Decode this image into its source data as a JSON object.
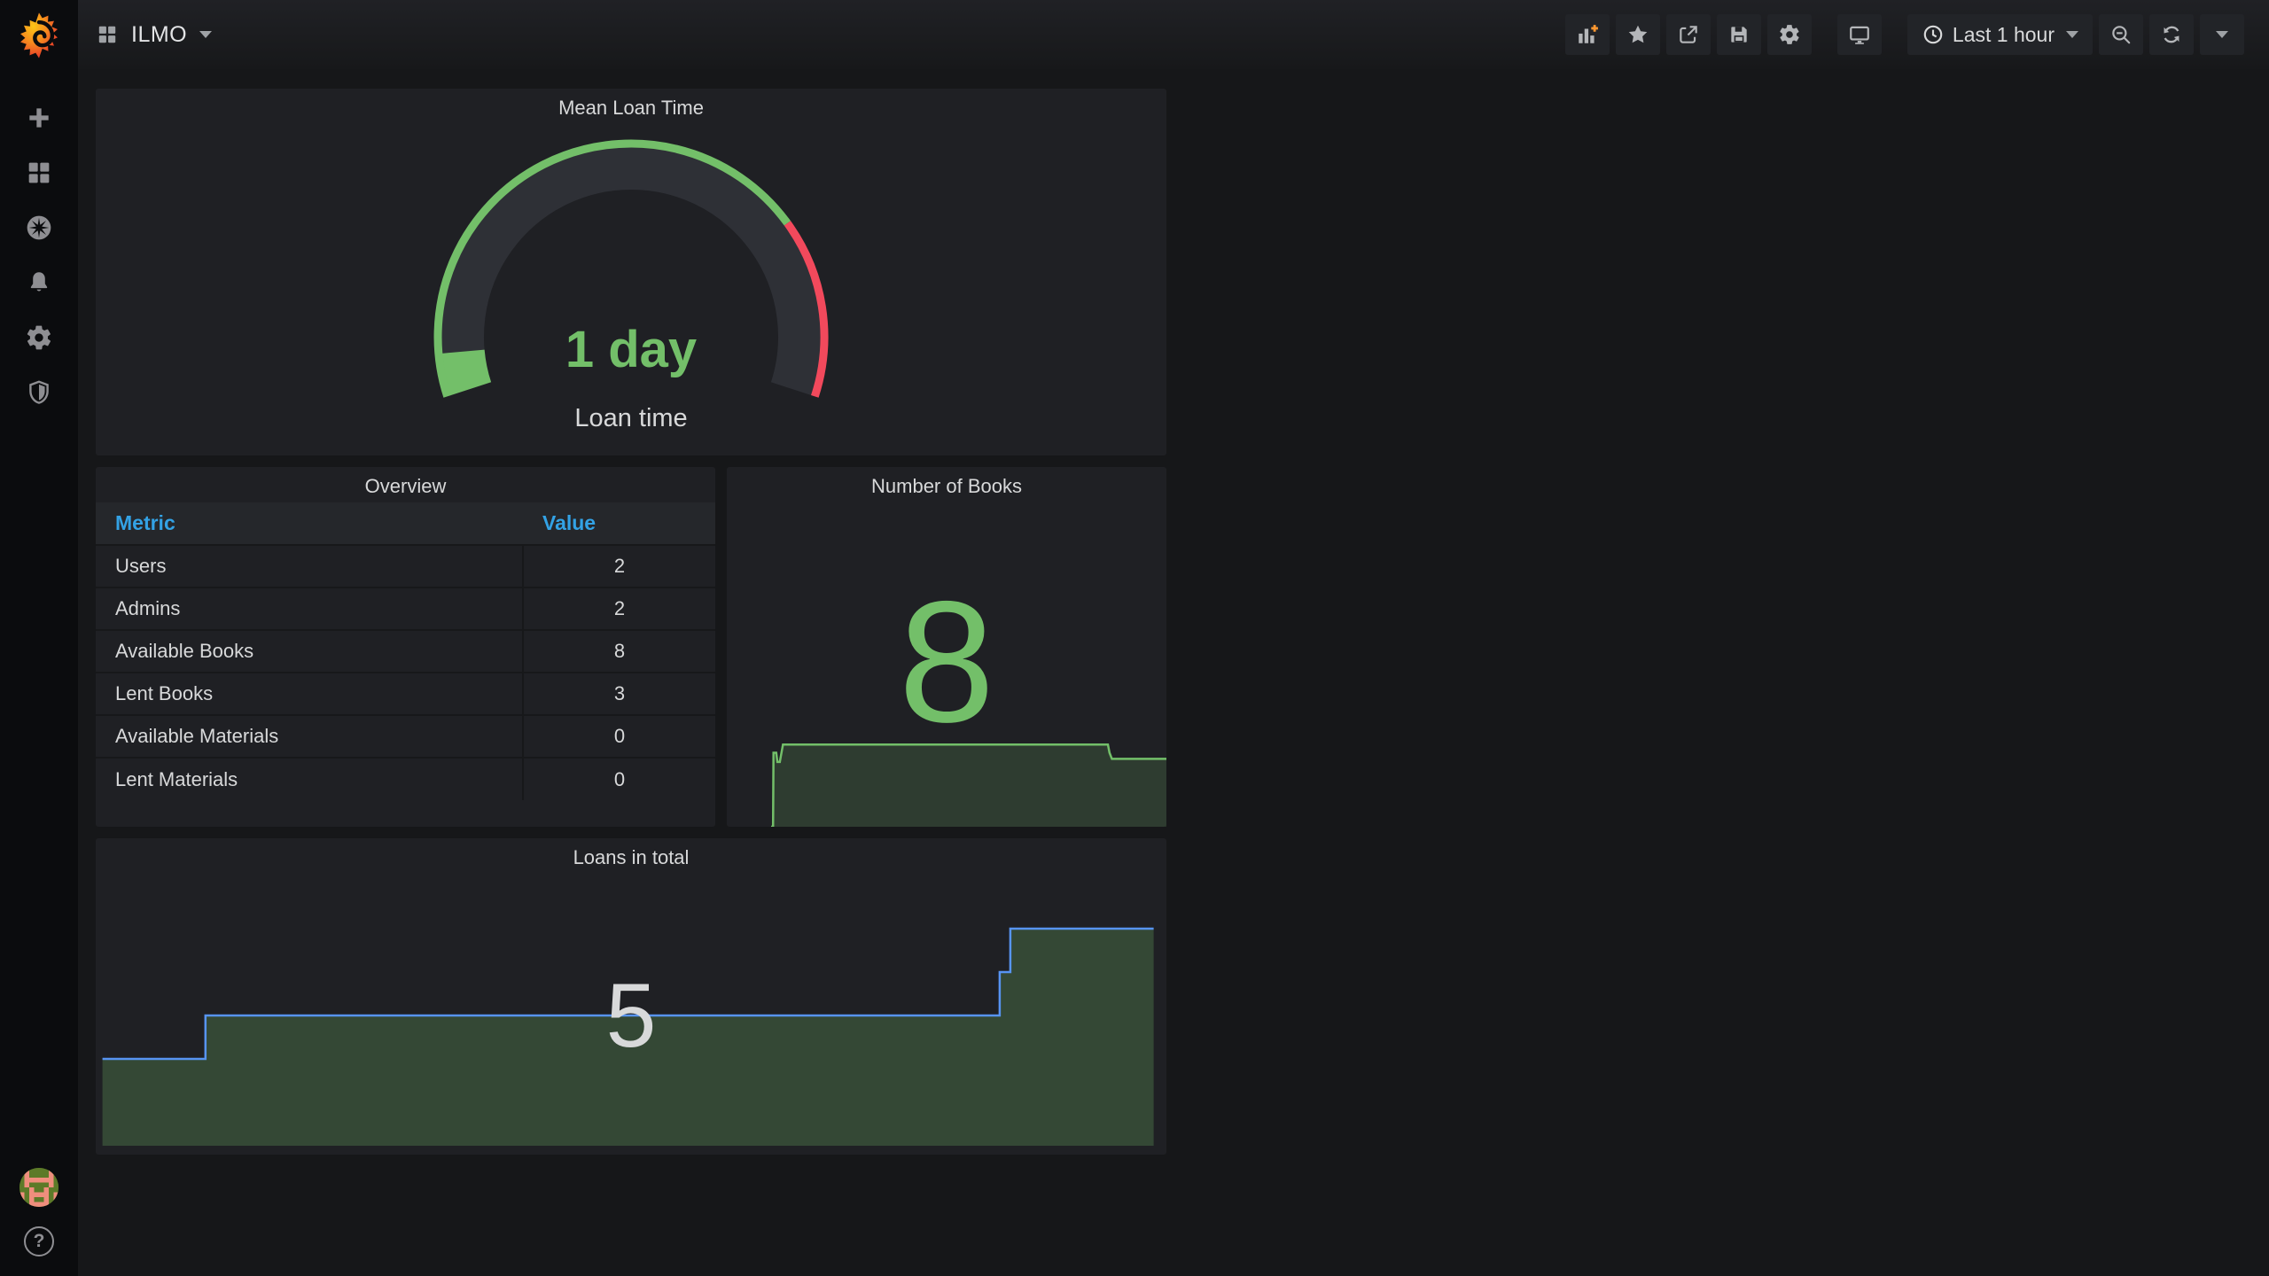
{
  "navbar": {
    "title": "ILMO",
    "time_picker_label": "Last 1 hour"
  },
  "sidebar": {
    "icons": [
      "grafana-logo",
      "create-plus",
      "dashboards",
      "explore-compass",
      "alerting-bell",
      "configuration-gear",
      "server-admin-shield"
    ],
    "bottom_icons": [
      "user-avatar",
      "help-question"
    ],
    "help_glyph": "?"
  },
  "panels": {
    "gauge": {
      "title": "Mean Loan Time",
      "value": "1 day",
      "label": "Loan time"
    },
    "overview": {
      "title": "Overview",
      "columns": [
        "Metric",
        "Value"
      ],
      "rows": [
        [
          "Users",
          "2"
        ],
        [
          "Admins",
          "2"
        ],
        [
          "Available Books",
          "8"
        ],
        [
          "Lent Books",
          "3"
        ],
        [
          "Available Materials",
          "0"
        ],
        [
          "Lent Materials",
          "0"
        ]
      ]
    },
    "books": {
      "title": "Number of Books",
      "value": "8"
    },
    "loans": {
      "title": "Loans in total",
      "value": "5"
    }
  },
  "colors": {
    "page_bg": "#161719",
    "panel_bg": "#1f2024",
    "sidebar_bg": "#0b0c0e",
    "text": "#d8d9da",
    "table_header_blue": "#33a2e5",
    "green": "#73bf69",
    "red": "#f2495c",
    "blue_line": "#5794f2",
    "gauge_track": "#2e3036",
    "orange_accent": "#ff9830",
    "books_fill": "rgba(115,191,105,0.18)",
    "loans_fill": "rgba(115,191,105,0.25)"
  },
  "chart_data": [
    {
      "type": "gauge",
      "title": "Mean Loan Time",
      "value_text": "1 day",
      "value_fraction": 0.06,
      "threshold_fraction": 0.75,
      "start_deg": 162,
      "span_deg": 216,
      "color_ok": "#73bf69",
      "color_limit": "#f2495c",
      "track_color": "#2e3036"
    },
    {
      "type": "area",
      "title": "Number of Books",
      "current": 8,
      "points": [
        [
          0,
          0
        ],
        [
          0.005,
          0
        ],
        [
          0.006,
          7.2
        ],
        [
          0.013,
          7.2
        ],
        [
          0.016,
          6.3
        ],
        [
          0.022,
          6.3
        ],
        [
          0.03,
          8
        ],
        [
          0.852,
          8
        ],
        [
          0.856,
          7.2
        ],
        [
          0.862,
          6.6
        ],
        [
          1,
          6.6
        ]
      ],
      "line_color": "#73bf69",
      "fill_color": "rgba(115,191,105,0.18)",
      "ylim": [
        0,
        9
      ],
      "legend": "off",
      "grid": "off"
    },
    {
      "type": "area",
      "title": "Loans in total",
      "current": 5,
      "points": [
        [
          0.003,
          2
        ],
        [
          0.1,
          2
        ],
        [
          0.1,
          3
        ],
        [
          0.848,
          3
        ],
        [
          0.848,
          4
        ],
        [
          0.858,
          4
        ],
        [
          0.858,
          5
        ],
        [
          0.993,
          5
        ]
      ],
      "line_color": "#5794f2",
      "fill_color": "rgba(115,191,105,0.25)",
      "ylim": [
        0,
        7.3
      ],
      "legend": "off",
      "grid": "off"
    }
  ]
}
